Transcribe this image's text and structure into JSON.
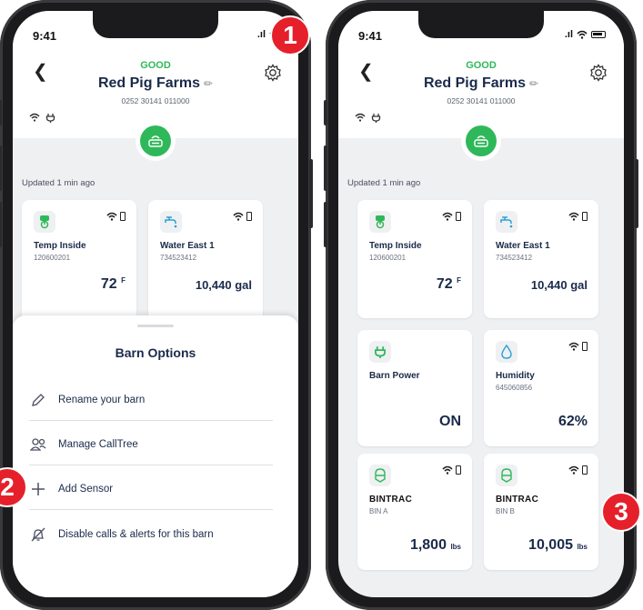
{
  "status_bar": {
    "time": "9:41",
    "signal": ".ıl"
  },
  "header": {
    "health": "GOOD",
    "farm_name": "Red Pig Farms",
    "farm_id": "0252 30141 011000"
  },
  "updated": "Updated 1 min ago",
  "cards": {
    "temp": {
      "name": "Temp Inside",
      "id": "120600201",
      "value": "72",
      "unit": "F"
    },
    "water": {
      "name": "Water East 1",
      "id": "734523412",
      "value": "10,440 gal"
    },
    "power": {
      "name": "Barn Power",
      "value": "ON"
    },
    "humidity": {
      "name": "Humidity",
      "id": "645060856",
      "value": "62%"
    },
    "bin_a": {
      "brand": "BINTRAC",
      "id": "BIN A",
      "value": "1,800",
      "unit": "lbs"
    },
    "bin_b": {
      "brand": "BINTRAC",
      "id": "BIN B",
      "value": "10,005",
      "unit": "lbs"
    }
  },
  "sheet": {
    "title": "Barn Options",
    "options": [
      {
        "label": "Rename your barn",
        "icon": "pencil-icon"
      },
      {
        "label": "Manage CallTree",
        "icon": "people-icon"
      },
      {
        "label": "Add Sensor",
        "icon": "plus-icon"
      },
      {
        "label": "Disable calls & alerts for this barn",
        "icon": "bell-off-icon"
      }
    ]
  },
  "badges": [
    "1",
    "2",
    "3"
  ],
  "colors": {
    "good": "#2fb85a",
    "badge": "#e5202a",
    "navy": "#1a2a4a"
  }
}
